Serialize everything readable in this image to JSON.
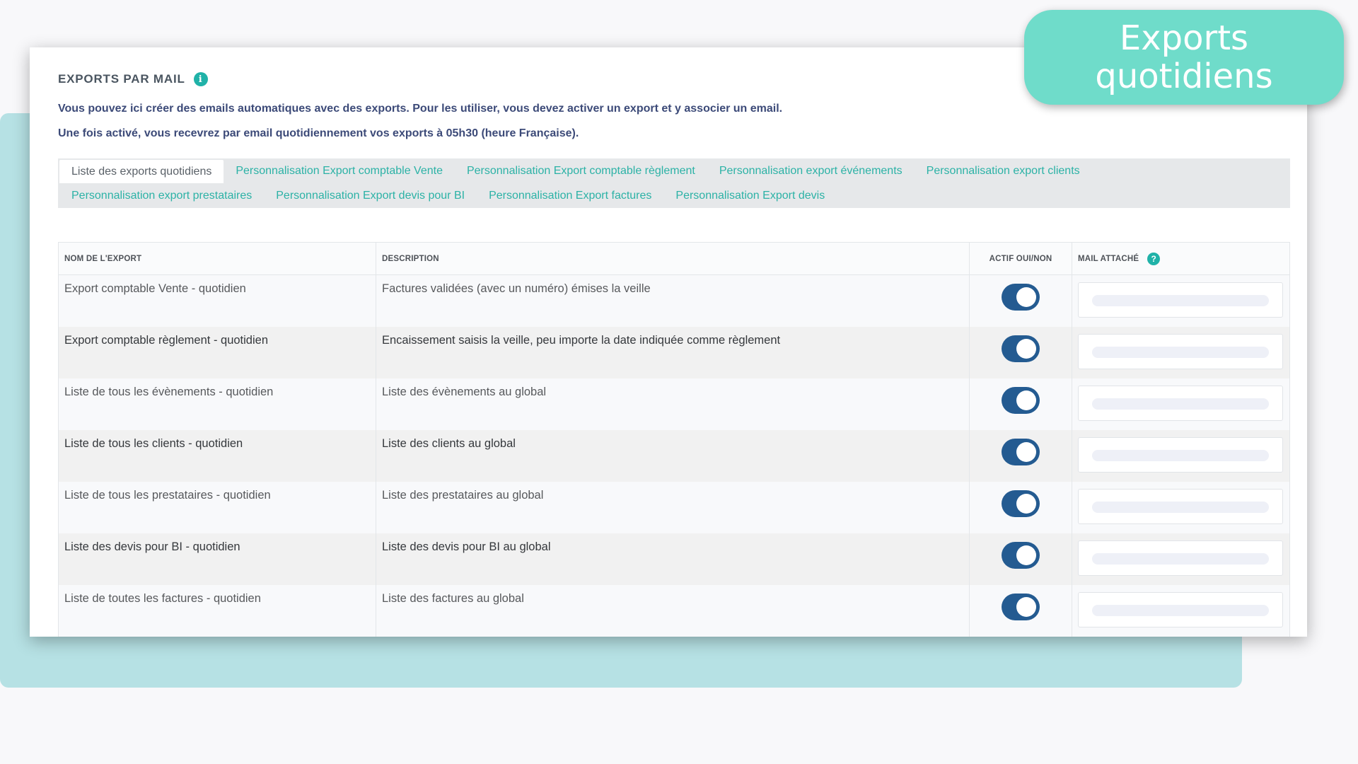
{
  "badge": {
    "line1": "Exports",
    "line2": "quotidiens"
  },
  "section": {
    "title": "EXPORTS PAR MAIL",
    "intro_line1": "Vous pouvez ici créer des emails automatiques avec des exports. Pour les utiliser, vous devez activer un export et y associer un email.",
    "intro_line2": "Une fois activé, vous recevrez par email quotidiennement vos exports à 05h30 (heure Française)."
  },
  "tabs": {
    "row1": [
      "Liste des exports quotidiens",
      "Personnalisation Export comptable Vente",
      "Personnalisation Export comptable règlement",
      "Personnalisation export événements",
      "Personnalisation export clients"
    ],
    "row2": [
      "Personnalisation export prestataires",
      "Personnalisation Export devis pour BI",
      "Personnalisation Export factures",
      "Personnalisation Export devis"
    ],
    "active": "Liste des exports quotidiens"
  },
  "table": {
    "headers": [
      "NOM DE L'EXPORT",
      "DESCRIPTION",
      "ACTIF OUI/NON",
      "MAIL ATTACHÉ"
    ],
    "rows": [
      {
        "name": "Export comptable Vente - quotidien",
        "description": "Factures validées (avec un numéro) émises la veille",
        "active": true
      },
      {
        "name": "Export comptable règlement - quotidien",
        "description": "Encaissement saisis la veille, peu importe la date indiquée comme règlement",
        "active": true
      },
      {
        "name": "Liste de tous les évènements - quotidien",
        "description": "Liste des évènements au global",
        "active": true
      },
      {
        "name": "Liste de tous les clients - quotidien",
        "description": "Liste des clients au global",
        "active": true
      },
      {
        "name": "Liste de tous les prestataires - quotidien",
        "description": "Liste des prestataires au global",
        "active": true
      },
      {
        "name": "Liste des devis pour BI - quotidien",
        "description": "Liste des devis pour BI au global",
        "active": true
      },
      {
        "name": "Liste de toutes les factures - quotidien",
        "description": "Liste des factures au global",
        "active": true
      }
    ]
  },
  "colors": {
    "accent": "#20b2a8",
    "toggle_on": "#245b91",
    "badge": "#6fdcca",
    "backdrop": "#b6e1e4"
  },
  "icons": {
    "info": "info-icon",
    "help": "help-icon"
  }
}
